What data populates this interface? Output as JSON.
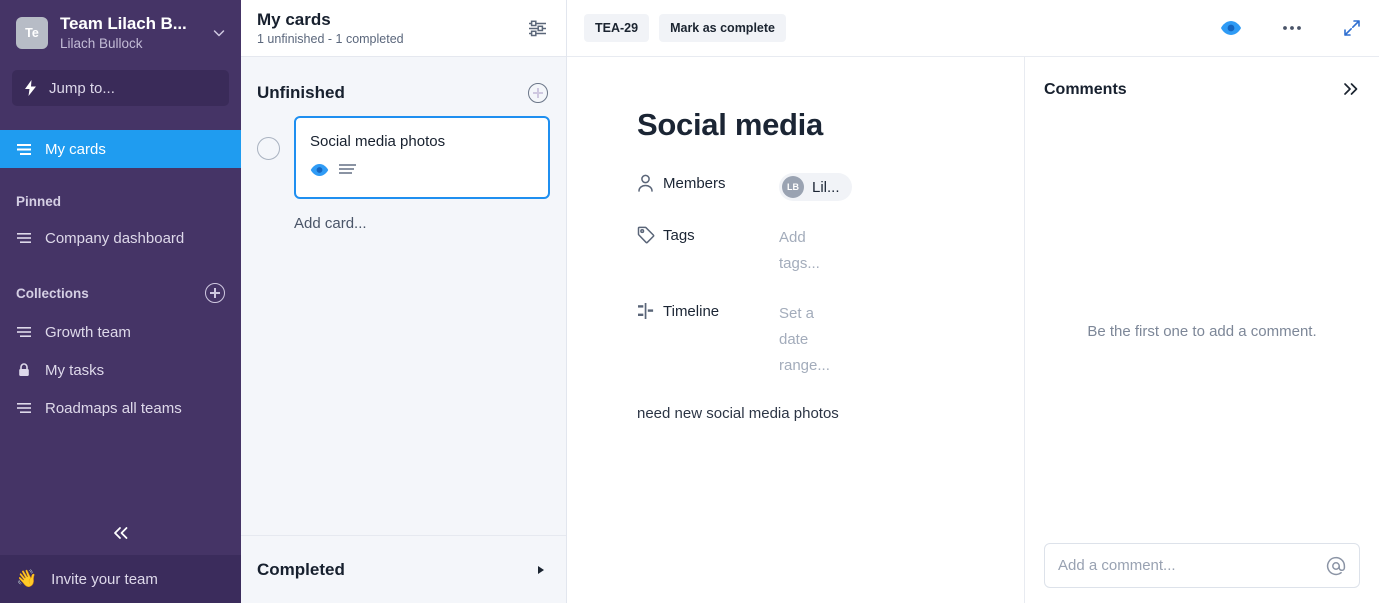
{
  "sidebar": {
    "team": {
      "avatar_initials": "Te",
      "name": "Team Lilach B...",
      "user": "Lilach Bullock",
      "chevron_icon": "chevron-down-icon"
    },
    "jump_to": {
      "label": "Jump to...",
      "icon": "lightning-bolt-icon"
    },
    "nav": [
      {
        "label": "My cards",
        "icon": "list-icon",
        "active": true
      }
    ],
    "pinned": {
      "label": "Pinned",
      "items": [
        {
          "label": "Company dashboard",
          "icon": "list-icon"
        }
      ]
    },
    "collections": {
      "label": "Collections",
      "add_icon": "plus-circle-icon",
      "items": [
        {
          "label": "Growth team",
          "icon": "list-icon"
        },
        {
          "label": "My tasks",
          "icon": "lock-icon"
        },
        {
          "label": "Roadmaps all teams",
          "icon": "list-icon"
        }
      ]
    },
    "collapse_icon": "double-chevron-left-icon",
    "invite": {
      "label": "Invite your team",
      "icon": "waving-hand-icon"
    },
    "colors": {
      "bg": "#453466",
      "active": "#1f9cf0",
      "footer": "#3b2c5c"
    }
  },
  "list_panel": {
    "title": "My cards",
    "subtitle": "1 unfinished - 1 completed",
    "filter_icon": "sliders-icon",
    "groups": {
      "unfinished": {
        "title": "Unfinished",
        "add_icon": "plus-circle-icon",
        "cards": [
          {
            "title": "Social media photos",
            "watch_icon": "eye-icon",
            "description_icon": "description-lines-icon"
          }
        ],
        "add_card_label": "Add card..."
      },
      "completed": {
        "title": "Completed",
        "expand_icon": "triangle-right-icon"
      }
    }
  },
  "detail": {
    "toolbar": {
      "card_id": "TEA-29",
      "mark_complete_label": "Mark as complete",
      "watch_icon": "eye-icon",
      "more_icon": "ellipsis-icon",
      "expand_icon": "expand-arrows-icon"
    },
    "title": "Social media",
    "fields": [
      {
        "label": "Members",
        "icon": "person-icon",
        "value": "Lil...",
        "avatar_initials": "LB",
        "type": "member"
      },
      {
        "label": "Tags",
        "icon": "tag-icon",
        "value": "Add tags...",
        "type": "placeholder"
      },
      {
        "label": "Timeline",
        "icon": "timeline-icon",
        "value": "Set a date range...",
        "type": "placeholder"
      }
    ],
    "description": "need new social media photos"
  },
  "comments": {
    "title": "Comments",
    "collapse_icon": "double-chevron-right-icon",
    "empty_text": "Be the first one to add a comment.",
    "input_placeholder": "Add a comment...",
    "mention_icon": "at-icon"
  }
}
